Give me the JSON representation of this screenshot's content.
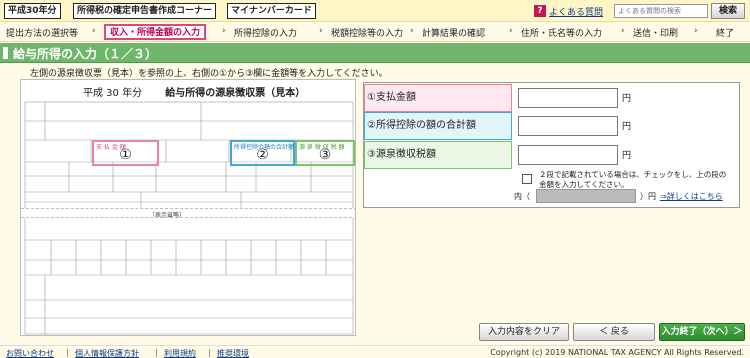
{
  "header": {
    "tags": [
      "平成30年分",
      "所得税の確定申告書作成コーナー",
      "マイナンバーカード"
    ],
    "faq_label": "よくある質問",
    "search_placeholder": "よくある質問の検索",
    "search_button": "検索"
  },
  "steps": [
    "提出方法の選択等",
    "収入・所得金額の入力",
    "所得控除の入力",
    "税額控除等の入力",
    "計算結果の確認",
    "住所・氏名等の入力",
    "送信・印刷",
    "終了"
  ],
  "active_step": "収入・所得金額の入力",
  "page": {
    "title": "給与所得の入力（１／３）",
    "instruction": "左側の源泉徴収票（見本）を参照の上、右側の①から③欄に金額等を入力してください。"
  },
  "sample": {
    "year_label": "平成 30 年分",
    "title": "給与所得の源泉徴収票（見本）",
    "highlight_numbers": [
      "①",
      "②",
      "③"
    ],
    "highlight_captions": [
      "支 払 金 額",
      "所得控除の額の合計額",
      "源 泉 徴 収 税 額"
    ],
    "omitted_label": "（表示省略）"
  },
  "fields": [
    {
      "label": "①支払金額",
      "unit": "円",
      "value": "",
      "color": "#e8859b",
      "bg": "#fde9ef"
    },
    {
      "label": "②所得控除の額の合計額",
      "unit": "円",
      "value": "",
      "color": "#3fa9d6",
      "bg": "#e3f4fb"
    },
    {
      "label": "③源泉徴収税額",
      "unit": "円",
      "value": "",
      "color": "#7cc46a",
      "bg": "#e9f7e4"
    }
  ],
  "checkbox_text": "２段で記載されている場合は、チェックをし、上の段の金額を入力してください。",
  "inner": {
    "label": "内（",
    "unit": "）円",
    "value": ""
  },
  "detail_link": "⇒詳しくはこちら",
  "buttons": {
    "clear": "入力内容をクリア",
    "back": "＜ 戻る",
    "finish": "入力終了（次へ）＞"
  },
  "footer": {
    "links": [
      "お問い合わせ",
      "個人情報保護方針",
      "利用規約",
      "推奨環境"
    ],
    "copyright": "Copyright (c) 2019 NATIONAL TAX AGENCY All Rights Reserved."
  },
  "colors": {
    "title_bar": "#6fb56b",
    "active_step": "#c4004a",
    "accent_link": "#0d3a8a"
  }
}
